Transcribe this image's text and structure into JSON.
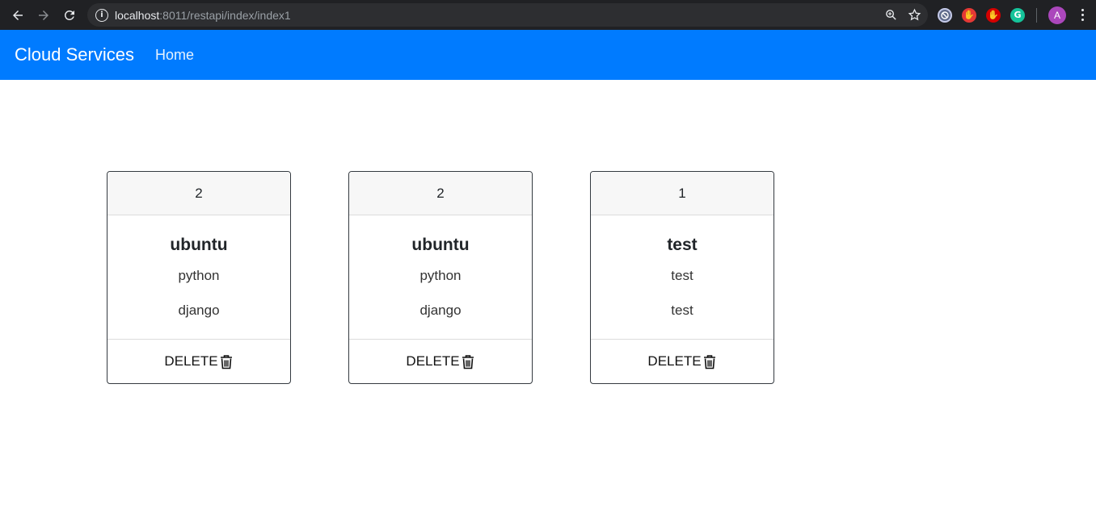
{
  "browser": {
    "url_host": "localhost",
    "url_rest": ":8011/restapi/index/index1",
    "avatar_letter": "A",
    "extensions": [
      {
        "name": "extension-blocker-icon",
        "color": "#8ab4f8"
      },
      {
        "name": "extension-adblock-icon",
        "color": "#e53935"
      },
      {
        "name": "extension-stop-icon",
        "color": "#d50000"
      },
      {
        "name": "extension-grammarly-icon",
        "color": "#15c39a"
      }
    ]
  },
  "navbar": {
    "brand": "Cloud Services",
    "links": [
      "Home"
    ],
    "color": "#007bff"
  },
  "cards": [
    {
      "header": "2",
      "title": "ubuntu",
      "line1": "python",
      "line2": "django",
      "action": "DELETE"
    },
    {
      "header": "2",
      "title": "ubuntu",
      "line1": "python",
      "line2": "django",
      "action": "DELETE"
    },
    {
      "header": "1",
      "title": "test",
      "line1": "test",
      "line2": "test",
      "action": "DELETE"
    }
  ]
}
